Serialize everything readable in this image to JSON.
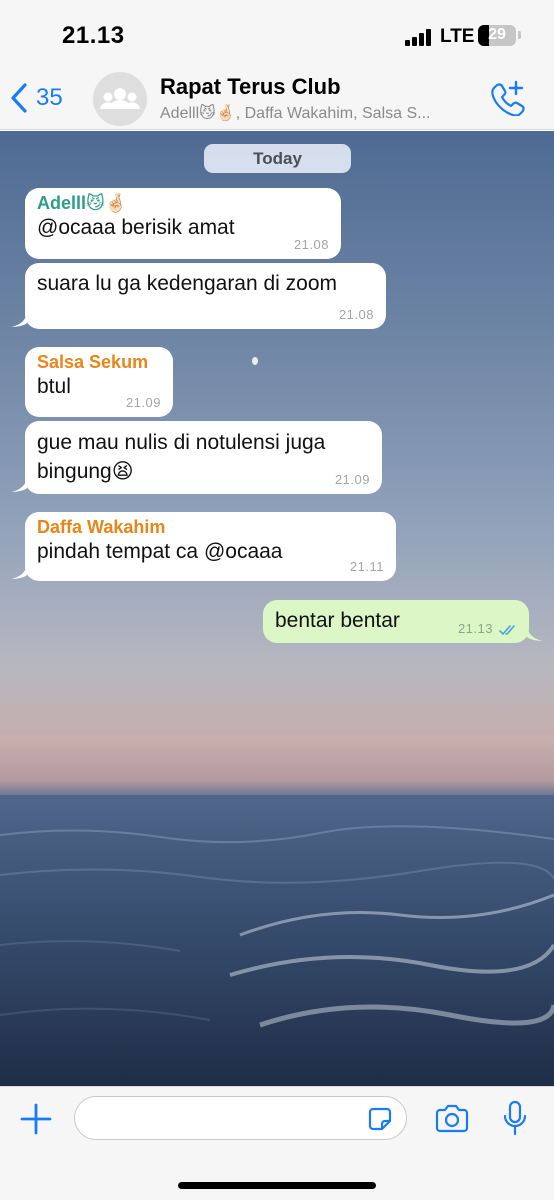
{
  "status_bar": {
    "time": "21.13",
    "network": "LTE",
    "battery": "29",
    "battery_level": 0.29
  },
  "header": {
    "back_count": "35",
    "title": "Rapat Terus Club",
    "members": "Adelll😼🤞🏻, Daffa Wakahim, Salsa S...",
    "back_icon": "chevron-left-icon",
    "avatar_icon": "group-avatar-icon",
    "call_icon": "add-call-icon"
  },
  "chat": {
    "date_label": "Today",
    "messages": [
      {
        "sender": "Adelll😼🤞🏻",
        "text": "@ocaaa berisik amat",
        "time": "21.08"
      },
      {
        "text": "suara lu ga kedengaran di zoom",
        "time": "21.08"
      },
      {
        "sender": "Salsa Sekum",
        "text": "btul",
        "time": "21.09"
      },
      {
        "text": "gue mau nulis di notulensi juga bingung😫",
        "time": "21.09"
      },
      {
        "sender": "Daffa Wakahim",
        "text": "pindah tempat ca @ocaaa",
        "time": "21.11"
      },
      {
        "text": "bentar bentar",
        "time": "21.13",
        "outgoing": true
      }
    ]
  },
  "input_bar": {
    "message_value": "",
    "plus_icon": "plus-icon",
    "sticker_icon": "sticker-icon",
    "camera_icon": "camera-icon",
    "mic_icon": "microphone-icon"
  },
  "colors": {
    "accent": "#1a7cf5",
    "sender_adelll": "#2e9c8c",
    "sender_salsa": "#e8861a",
    "sender_daffa": "#e8861a",
    "outgoing_bubble": "#dcf7c5",
    "read_ticks": "#4aa3df"
  }
}
